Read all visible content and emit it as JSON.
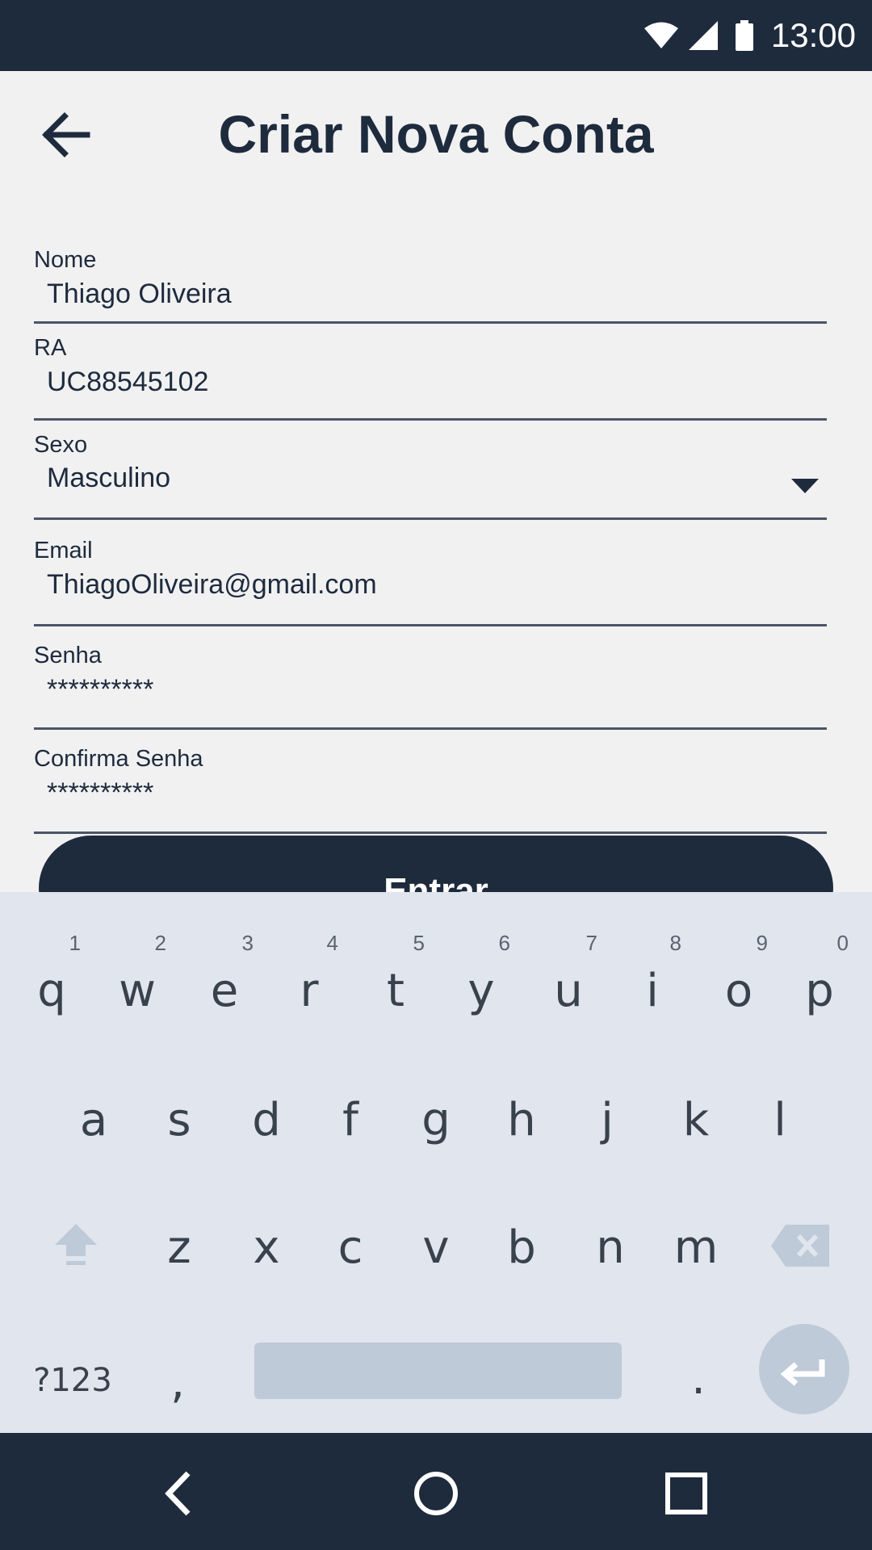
{
  "status_bar": {
    "time": "13:00",
    "icons": [
      "wifi-icon",
      "signal-icon",
      "battery-icon"
    ]
  },
  "header": {
    "title": "Criar Nova Conta",
    "back_icon": "arrow-back-icon"
  },
  "form": {
    "nome": {
      "label": "Nome",
      "value": "Thiago Oliveira"
    },
    "ra": {
      "label": "RA",
      "value": "UC88545102"
    },
    "sexo": {
      "label": "Sexo",
      "value": "Masculino"
    },
    "email": {
      "label": "Email",
      "value": "ThiagoOliveira@gmail.com"
    },
    "senha": {
      "label": "Senha",
      "value": "**********"
    },
    "confirma_senha": {
      "label": "Confirma Senha",
      "value": "**********"
    }
  },
  "submit_button": {
    "label": "Entrar"
  },
  "keyboard": {
    "row1": [
      {
        "key": "q",
        "hint": "1"
      },
      {
        "key": "w",
        "hint": "2"
      },
      {
        "key": "e",
        "hint": "3"
      },
      {
        "key": "r",
        "hint": "4"
      },
      {
        "key": "t",
        "hint": "5"
      },
      {
        "key": "y",
        "hint": "6"
      },
      {
        "key": "u",
        "hint": "7"
      },
      {
        "key": "i",
        "hint": "8"
      },
      {
        "key": "o",
        "hint": "9"
      },
      {
        "key": "p",
        "hint": "0"
      }
    ],
    "row2": [
      "a",
      "s",
      "d",
      "f",
      "g",
      "h",
      "j",
      "k",
      "l"
    ],
    "row3": [
      "z",
      "x",
      "c",
      "v",
      "b",
      "n",
      "m"
    ],
    "symbols_key": "?123",
    "comma_key": ",",
    "period_key": "."
  },
  "colors": {
    "primary": "#1e2b3d",
    "background": "#f1f1f2",
    "keyboard_bg": "#e0e5ee",
    "key_accent": "#bfcad8"
  }
}
